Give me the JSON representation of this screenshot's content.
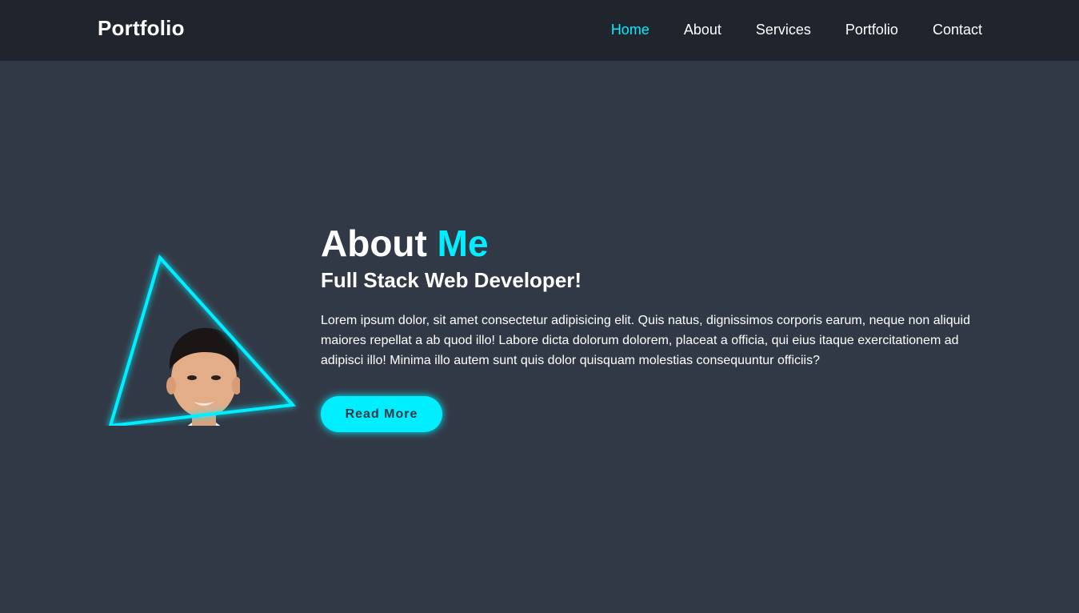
{
  "header": {
    "logo": "Portfolio",
    "nav": [
      {
        "label": "Home",
        "active": true
      },
      {
        "label": "About",
        "active": false
      },
      {
        "label": "Services",
        "active": false
      },
      {
        "label": "Portfolio",
        "active": false
      },
      {
        "label": "Contact",
        "active": false
      }
    ]
  },
  "about": {
    "heading_main": "About",
    "heading_accent": "Me",
    "subheading": "Full Stack Web Developer!",
    "description": "Lorem ipsum dolor, sit amet consectetur adipisicing elit. Quis natus, dignissimos corporis earum, neque non aliquid maiores repellat a ab quod illo! Labore dicta dolorum dolorem, placeat a officia, qui eius itaque exercitationem ad adipisci illo! Minima illo autem sunt quis dolor quisquam molestias consequuntur officiis?",
    "button_label": "Read More"
  },
  "colors": {
    "accent": "#00eeff",
    "background": "#323946",
    "header_background": "#1f242d"
  }
}
